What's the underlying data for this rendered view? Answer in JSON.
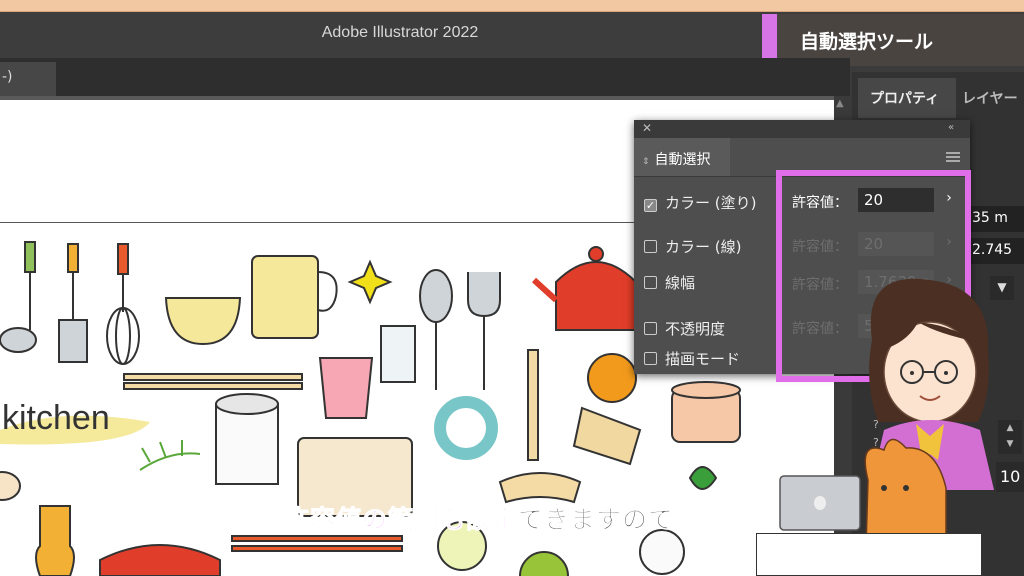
{
  "window": {
    "app_title": "Adobe Illustrator 2022"
  },
  "tool_badge": {
    "label": "自動選択ツール",
    "accent": "#d774e6"
  },
  "doc_tab": {
    "label": "-)"
  },
  "artboard": {
    "kitchen_text": "kitchen"
  },
  "right_panel": {
    "tabs": [
      "プロパティ",
      "レイヤー"
    ],
    "values": {
      "v1": "35 m",
      "v2": "2.745",
      "v3": "10"
    }
  },
  "dialog": {
    "tab_label": "自動選択",
    "options": [
      {
        "label": "カラー (塗り)",
        "checked": true,
        "tol_label": "許容値：",
        "tol_value": "20",
        "enabled": true
      },
      {
        "label": "カラー (線)",
        "checked": false,
        "tol_label": "許容値：",
        "tol_value": "20",
        "enabled": false
      },
      {
        "label": "線幅",
        "checked": false,
        "tol_label": "許容値：",
        "tol_value": "1.7639 r",
        "enabled": false
      },
      {
        "label": "不透明度",
        "checked": false,
        "tol_label": "許容値：",
        "tol_value": "5%",
        "enabled": false
      },
      {
        "label": "描画モード",
        "checked": false
      }
    ],
    "highlight_color": "#e06ee8"
  },
  "caption": {
    "highlight": "許容値の範囲も設定",
    "rest": "できますので"
  }
}
